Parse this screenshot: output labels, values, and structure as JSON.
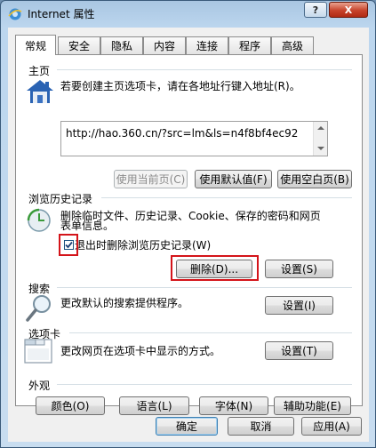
{
  "window": {
    "title": "Internet 属性",
    "help_label": "?",
    "close_label": "X"
  },
  "tabs": [
    "常规",
    "安全",
    "隐私",
    "内容",
    "连接",
    "程序",
    "高级"
  ],
  "home": {
    "section_title": "主页",
    "description": "若要创建主页选项卡，请在各地址行键入地址(R)。",
    "url": "http://hao.360.cn/?src=lm&ls=n4f8bf4ec92",
    "btn_current": "使用当前页(C)",
    "btn_default": "使用默认值(F)",
    "btn_blank": "使用空白页(B)"
  },
  "history": {
    "section_title": "浏览历史记录",
    "description_line1": "删除临时文件、历史记录、Cookie、保存的密码和网页",
    "description_line2": "表单信息。",
    "checkbox_label": "退出时删除浏览历史记录(W)",
    "checkbox_checked": true,
    "btn_delete": "删除(D)...",
    "btn_settings": "设置(S)"
  },
  "search": {
    "section_title": "搜索",
    "description": "更改默认的搜索提供程序。",
    "btn_settings": "设置(I)"
  },
  "tabs_section": {
    "section_title": "选项卡",
    "description": "更改网页在选项卡中显示的方式。",
    "btn_settings": "设置(T)"
  },
  "appearance": {
    "section_title": "外观",
    "btn_colors": "颜色(O)",
    "btn_languages": "语言(L)",
    "btn_fonts": "字体(N)",
    "btn_accessibility": "辅助功能(E)"
  },
  "footer": {
    "ok": "确定",
    "cancel": "取消",
    "apply": "应用(A)"
  },
  "colors": {
    "highlight": "#d4141a",
    "accent": "#3c7fb1"
  }
}
